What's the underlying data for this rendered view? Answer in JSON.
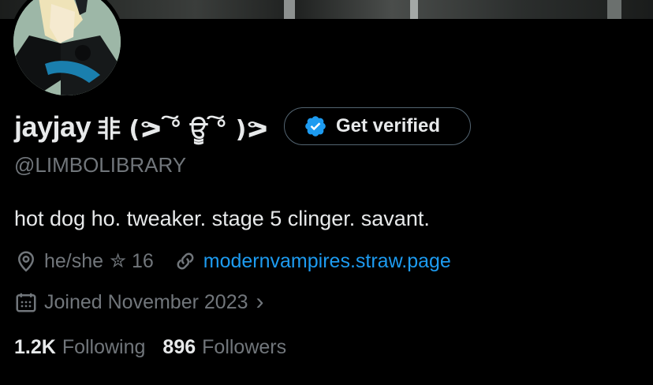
{
  "profile": {
    "display_name": "jayjay",
    "name_decoration": "⾮ (ᕗ ͠° ਊ ͠° )ᕗ",
    "handle": "@LIMBOLIBRARY",
    "verify_label": "Get verified",
    "bio": "hot dog ho. tweaker. stage 5 clinger. savant.",
    "pronouns": "he/she",
    "extra": "✮ 16",
    "website": "modernvampires.straw.page",
    "joined": "Joined November 2023",
    "joined_chevron": "›",
    "following_count": "1.2K",
    "following_label": "Following",
    "followers_count": "896",
    "followers_label": "Followers"
  },
  "colors": {
    "background": "#000000",
    "text_primary": "#e7e9ea",
    "text_secondary": "#71767b",
    "link": "#1d9bf0",
    "verified_badge": "#1d9bf0"
  },
  "icons": {
    "verify": "verified-badge-icon",
    "location": "location-pin-icon",
    "link": "link-icon",
    "calendar": "calendar-icon"
  }
}
